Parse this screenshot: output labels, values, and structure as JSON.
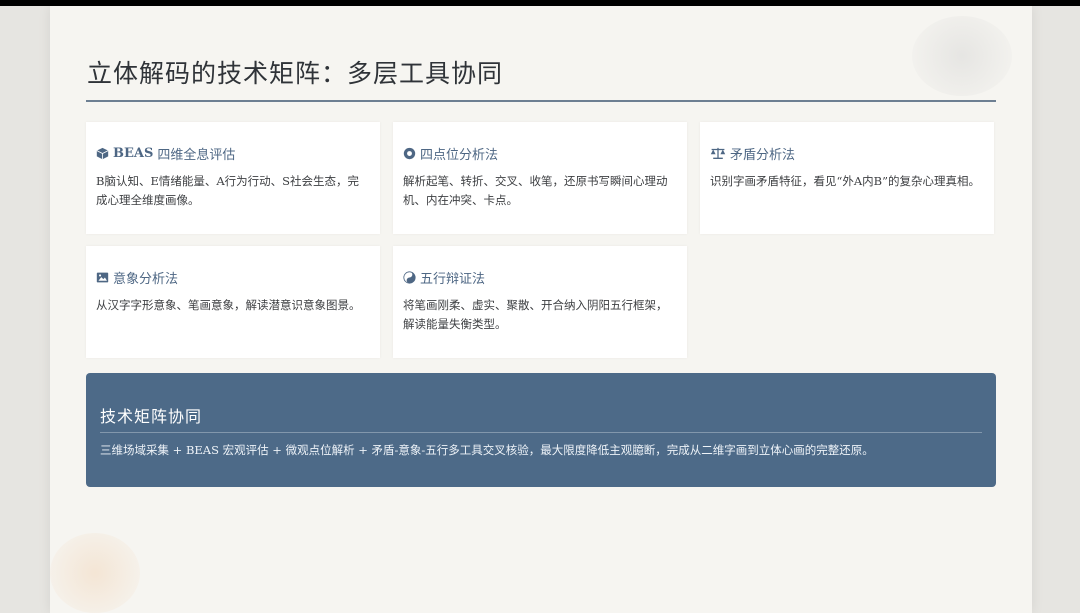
{
  "slide": {
    "title": "立体解码的技术矩阵：多层工具协同"
  },
  "cards": [
    {
      "icon": "cube-icon",
      "title_bold": "BEAS",
      "title": "四维全息评估",
      "body": "B脑认知、E情绪能量、A行为行动、S社会生态，完成心理全维度画像。"
    },
    {
      "icon": "dot-circle-icon",
      "title": "四点位分析法",
      "body": "解析起笔、转折、交叉、收笔，还原书写瞬间心理动机、内在冲突、卡点。"
    },
    {
      "icon": "balance-scale-icon",
      "title": "矛盾分析法",
      "body": "识别字画矛盾特征，看见“外A内B”的复杂心理真相。"
    },
    {
      "icon": "image-icon",
      "title": "意象分析法",
      "body": "从汉字字形意象、笔画意象，解读潜意识意象图景。"
    },
    {
      "icon": "yin-yang-icon",
      "title": "五行辩证法",
      "body": "将笔画刚柔、虚实、聚散、开合纳入阴阳五行框架，解读能量失衡类型。"
    }
  ],
  "summary": {
    "title": "技术矩阵协同",
    "body": "三维场域采集 + BEAS 宏观评估 + 微观点位解析 + 矛盾-意象-五行多工具交叉核验，最大限度降低主观臆断，完成从二维字画到立体心画的完整还原。"
  },
  "colors": {
    "accent": "#4d6a88",
    "card_title": "#4e6784",
    "background": "#f6f5f1"
  }
}
